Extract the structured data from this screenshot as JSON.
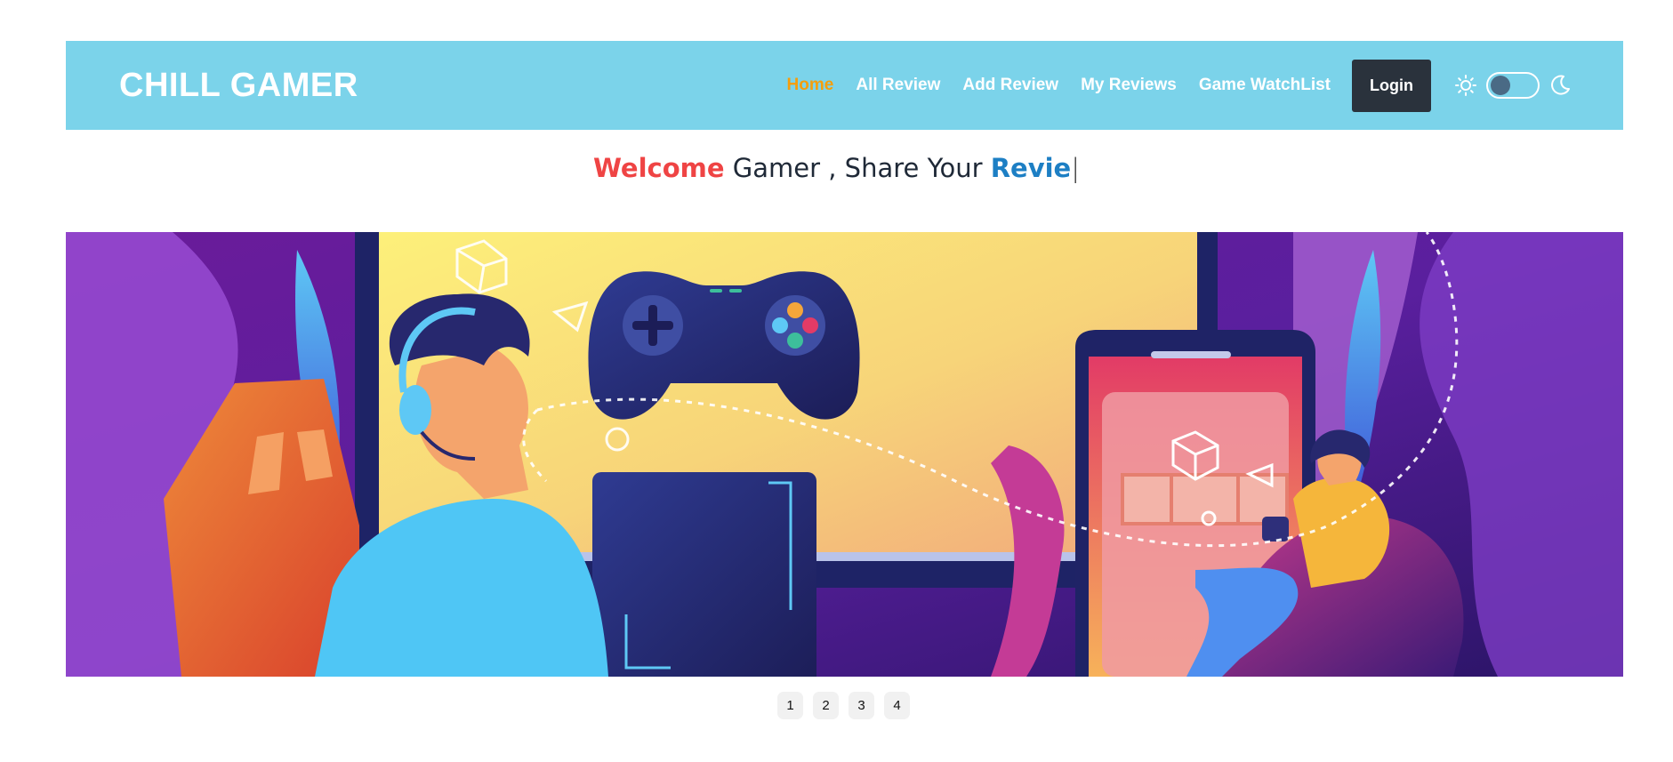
{
  "brand": "CHILL GAMER",
  "nav": {
    "links": [
      "Home",
      "All Review",
      "Add Review",
      "My Reviews",
      "Game WatchList"
    ],
    "active": "Home",
    "login_label": "Login"
  },
  "theme_toggle": {
    "light_icon": "sun-icon",
    "dark_icon": "moon-icon",
    "state": "off"
  },
  "headline": {
    "word1": "Welcome",
    "middle": " Gamer , Share Your ",
    "word2": "Revie",
    "cursor": "|"
  },
  "carousel": {
    "pages": [
      "1",
      "2",
      "3",
      "4"
    ]
  },
  "colors": {
    "navbar_bg": "#7bd3ea",
    "active_link": "#f59e0b",
    "login_bg": "#2a323c",
    "welcome": "#ef4444",
    "review": "#1d7fc4"
  }
}
